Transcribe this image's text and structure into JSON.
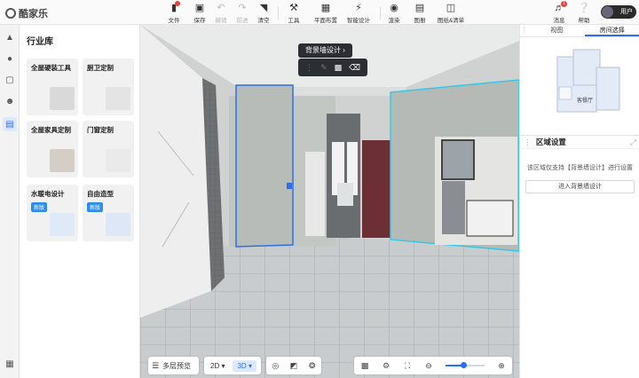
{
  "app": {
    "logo_text": "酷家乐"
  },
  "toolbar": {
    "file": "文件",
    "save": "保存",
    "undo": "撤销",
    "redo": "前进",
    "clear": "清空",
    "tools": "工具",
    "floor_plan": "平面布置",
    "smart_design": "智能设计",
    "render": "渲染",
    "gallery": "图册",
    "drawings": "图纸&清单",
    "messages": "消息",
    "help": "帮助",
    "user": "用户"
  },
  "library": {
    "title": "行业库",
    "cards": [
      {
        "label": "全屋硬装工具",
        "tag": ""
      },
      {
        "label": "厨卫定制",
        "tag": ""
      },
      {
        "label": "全屋家具定制",
        "tag": ""
      },
      {
        "label": "门窗定制",
        "tag": ""
      },
      {
        "label": "水暖电设计",
        "tag": "新版"
      },
      {
        "label": "自由造型",
        "tag": "新版"
      }
    ]
  },
  "viewport": {
    "wall_tip": "背景墙设计"
  },
  "bottom": {
    "multi_floor": "多层预览",
    "mode_2d": "2D",
    "mode_3d": "3D",
    "zoom_level": 0.45
  },
  "right": {
    "tabs": [
      "视图",
      "房间选择"
    ],
    "active_tab": 1,
    "minimap_room": "客餐厅",
    "region_title": "区域设置",
    "region_hint": "该区域仅支持【背景墙设计】进行设置",
    "region_button": "进入背景墙设计"
  },
  "colors": {
    "accent": "#2d6df6",
    "selection_blue": "#2f6fe0",
    "selection_cyan": "#34c9e6",
    "door": "#6b2f35"
  }
}
